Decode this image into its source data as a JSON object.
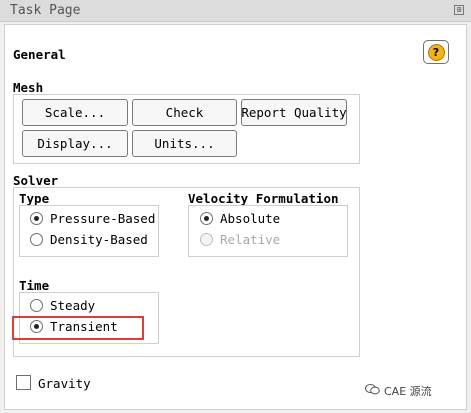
{
  "window": {
    "title": "Task Page"
  },
  "general": {
    "heading": "General",
    "help_icon": "question-mark-icon",
    "help_glyph": "?"
  },
  "mesh": {
    "label": "Mesh",
    "buttons": [
      "Scale...",
      "Check",
      "Report Quality",
      "Display...",
      "Units..."
    ]
  },
  "solver": {
    "label": "Solver",
    "type": {
      "label": "Type",
      "options": [
        "Pressure-Based",
        "Density-Based"
      ],
      "selected": "Pressure-Based"
    },
    "velocity_formulation": {
      "label": "Velocity Formulation",
      "options": [
        "Absolute",
        "Relative"
      ],
      "selected": "Absolute",
      "disabled": [
        "Relative"
      ]
    },
    "time": {
      "label": "Time",
      "options": [
        "Steady",
        "Transient"
      ],
      "selected": "Transient"
    }
  },
  "gravity": {
    "label": "Gravity",
    "checked": false
  },
  "watermark": {
    "text": "CAE 源流"
  },
  "colors": {
    "highlight": "#e03c3c",
    "help_icon": "#f2b21b"
  }
}
